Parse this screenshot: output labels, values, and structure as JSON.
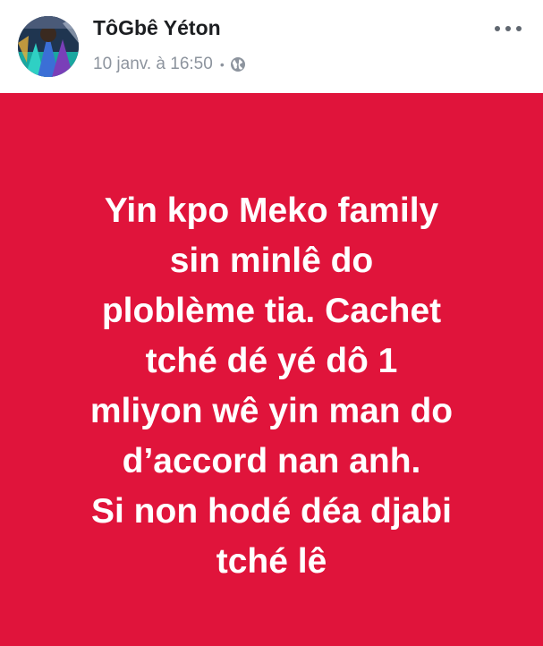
{
  "post": {
    "author": "TôGbê Yéton",
    "timestamp": "10 janv. à 16:50",
    "separator": "•",
    "privacy_icon": "globe-icon",
    "more_icon": "more-options-icon",
    "message": "Yin kpo Meko family\nsin minlê do\nploblème tia. Cachet\ntché dé yé dô 1\nmliyon wê yin man do\nd’accord nan anh.\nSi non hodé déa djabi\ntché lê",
    "background_color": "#e0143b",
    "text_color": "#ffffff"
  }
}
